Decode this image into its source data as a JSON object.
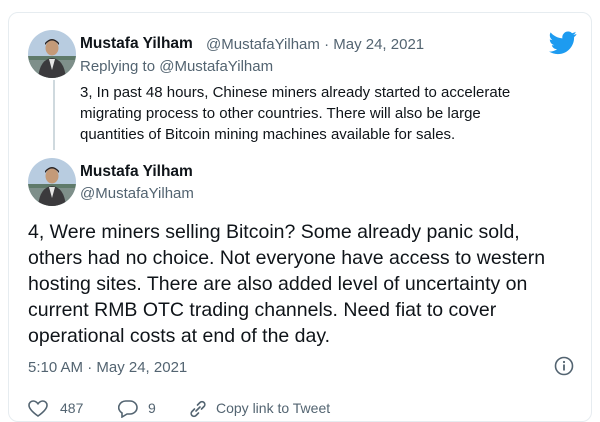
{
  "tweet1": {
    "name": "Mustafa Yilham",
    "handle": "@MustafaYilham",
    "sep": "·",
    "date": "May 24, 2021",
    "replying_prefix": "Replying to",
    "replying_handle": "@MustafaYilham",
    "text": "3, In past 48 hours, Chinese miners already started to accelerate\nmigrating process to other countries. There will also be large\nquantities of Bitcoin mining machines available for sales."
  },
  "tweet2": {
    "name": "Mustafa Yilham",
    "handle": "@MustafaYilham",
    "text": "4, Were miners selling Bitcoin? Some already panic sold,\nothers had no choice. Not everyone have access to western\nhosting sites. There are also added level of uncertainty on\ncurrent RMB OTC trading channels. Need fiat to cover\noperational costs at end of the day.",
    "timestamp": "5:10 AM · May 24, 2021"
  },
  "actions": {
    "like_count": "487",
    "reply_count": "9",
    "copy_link_label": "Copy link to Tweet"
  },
  "icons": {
    "brand": "twitter-bird-icon",
    "info": "info-icon",
    "like": "heart-icon",
    "reply": "speech-bubble-icon",
    "link": "link-icon"
  },
  "colors": {
    "twitter_blue": "#1d9bf0",
    "secondary_text": "#536471",
    "border": "#e6ecf0"
  }
}
